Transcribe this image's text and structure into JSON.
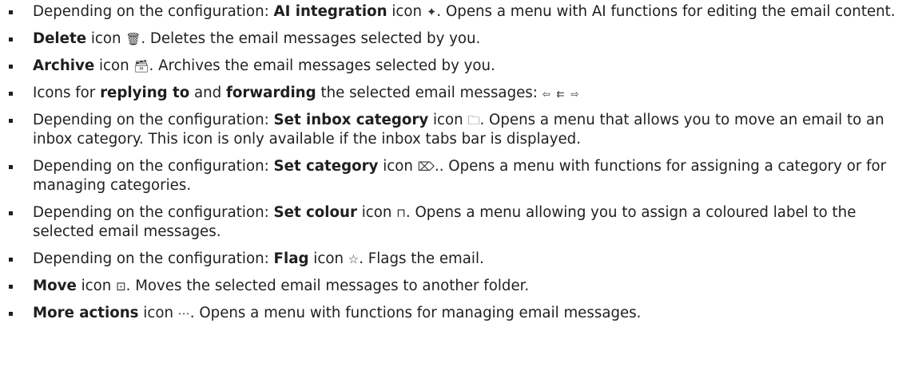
{
  "items": [
    {
      "before": "Depending on the configuration: ",
      "bold": "AI integration",
      "middle": " icon ",
      "icon_name": "ai-sparkle-icon",
      "icon_glyph": "✦",
      "after": ". Opens a menu with AI functions for editing the email content."
    },
    {
      "before": "",
      "bold": "Delete",
      "middle": " icon ",
      "icon_name": "trash-icon",
      "icon_glyph": "🗑",
      "after": ". Deletes the email messages selected by you."
    },
    {
      "before": "",
      "bold": "Archive",
      "middle": " icon ",
      "icon_name": "archive-icon",
      "icon_glyph": "🗃",
      "after": ". Archives the email messages selected by you."
    },
    {
      "before": "Icons for ",
      "bold": "replying to",
      "middle": " and ",
      "bold2": "forwarding",
      "middle2": " the selected email messages: ",
      "icon_name": "reply-replyall-forward-icons",
      "icon_glyph": "⇦ ⇇ ⇨",
      "after": ""
    },
    {
      "before": "Depending on the configuration: ",
      "bold": "Set inbox category",
      "middle": " icon ",
      "icon_name": "folder-icon",
      "icon_glyph": "🗀",
      "after": ". Opens a menu that allows you to move an email to an inbox category. This icon is only available if the inbox tabs bar is displayed."
    },
    {
      "before": "Depending on the configuration: ",
      "bold": "Set category",
      "middle": " icon ",
      "icon_name": "tag-icon",
      "icon_glyph": "⌦",
      "after": ".. Opens a menu with functions for assigning a category or for managing categories."
    },
    {
      "before": "Depending on the configuration: ",
      "bold": "Set colour",
      "middle": " icon ",
      "icon_name": "bookmark-icon",
      "icon_glyph": "⊓",
      "after": ". Opens a menu allowing you to assign a coloured label to the selected email messages."
    },
    {
      "before": "Depending on the configuration: ",
      "bold": "Flag",
      "middle": " icon ",
      "icon_name": "star-icon",
      "icon_glyph": "☆",
      "after": ". Flags the email."
    },
    {
      "before": "",
      "bold": "Move",
      "middle": " icon ",
      "icon_name": "move-folder-icon",
      "icon_glyph": "⊡",
      "after": ". Moves the selected email messages to another folder."
    },
    {
      "before": "",
      "bold": "More actions",
      "middle": " icon ",
      "icon_name": "more-icon",
      "icon_glyph": "⋯",
      "after": ". Opens a menu with functions for managing email messages."
    }
  ]
}
